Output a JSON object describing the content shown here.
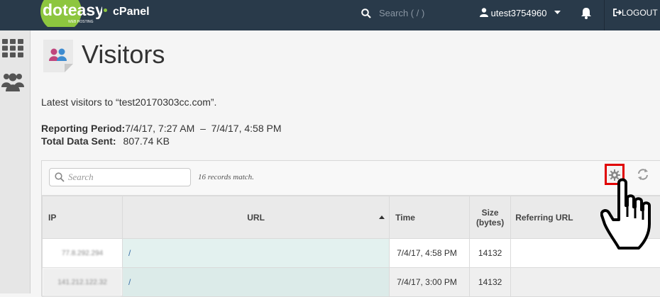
{
  "header": {
    "brand": "doteasy",
    "brand_sub": "WEB HOSTING",
    "product": "cPanel",
    "search_placeholder": "Search ( / )",
    "username": "utest3754960",
    "logout_label": "LOGOUT"
  },
  "page": {
    "title": "Visitors",
    "intro": "Latest visitors to “test20170303cc.com”.",
    "period_label": "Reporting Period:",
    "period_value": "7/4/17, 7:27 AM  –  7/4/17, 4:58 PM",
    "sent_label": "Total Data Sent:",
    "sent_value": "807.74 KB"
  },
  "toolbar": {
    "search_placeholder": "Search",
    "records_text": "16 records match."
  },
  "table": {
    "columns": [
      "IP",
      "URL",
      "Time",
      "Size (bytes)",
      "Referring URL"
    ],
    "rows": [
      {
        "ip": "77.8.292.294",
        "url": "/",
        "time": "7/4/17, 4:58 PM",
        "size": "14132",
        "ref": ""
      },
      {
        "ip": "141.212.122.32",
        "url": "/",
        "time": "7/4/17, 3:00 PM",
        "size": "14132",
        "ref": ""
      }
    ]
  },
  "colors": {
    "topbar": "#293a4a",
    "brand_green": "#8dc63f",
    "highlight": "#e00000"
  }
}
